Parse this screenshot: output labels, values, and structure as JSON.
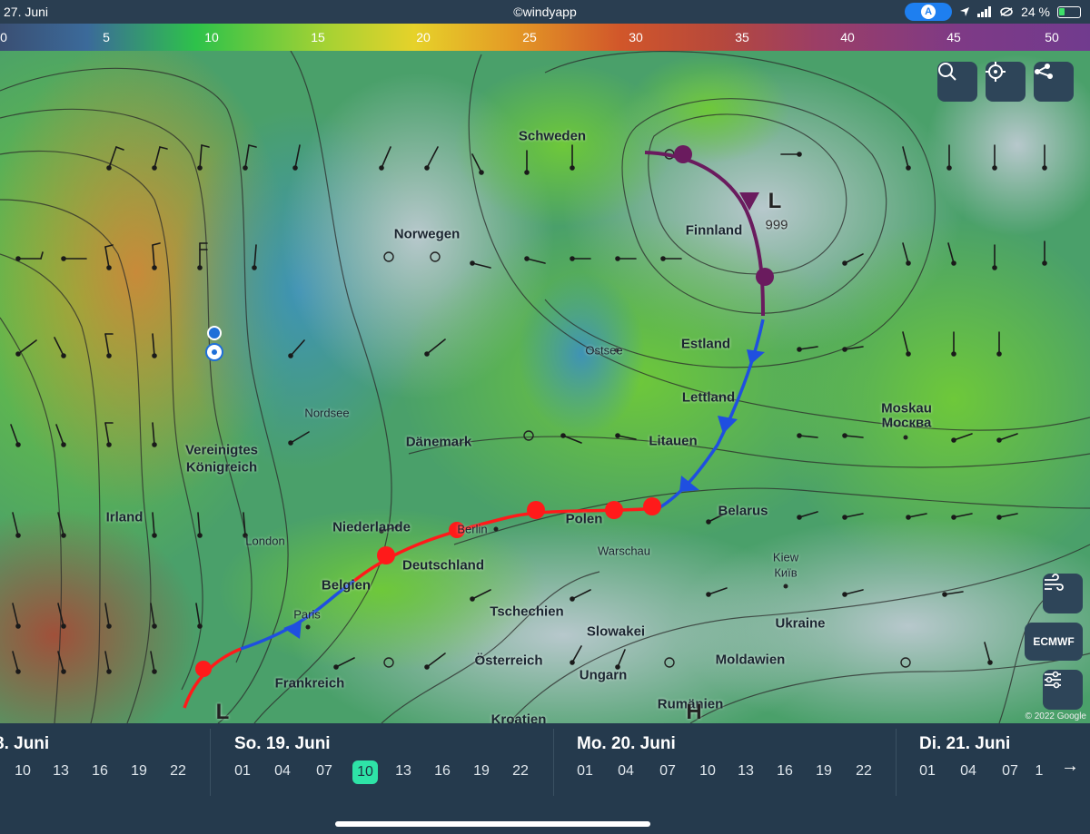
{
  "status": {
    "date": "27. Juni",
    "watermark": "©windyapp",
    "nav_letter": "A",
    "battery": "24 %"
  },
  "scale": {
    "ticks": [
      "0",
      "5",
      "10",
      "15",
      "20",
      "25",
      "30",
      "35",
      "40",
      "45",
      "50"
    ]
  },
  "map": {
    "labels": {
      "schweden": "Schweden",
      "norwegen": "Norwegen",
      "finnland": "Finnland",
      "estland": "Estland",
      "lettland": "Lettland",
      "litauen": "Litauen",
      "moskau_de": "Moskau",
      "moskau_ru": "Москва",
      "daenemark": "Dänemark",
      "nordsee": "Nordsee",
      "ver_koenigreich_1": "Vereinigtes",
      "ver_koenigreich_2": "Königreich",
      "irland": "Irland",
      "london": "London",
      "niederlande": "Niederlande",
      "berlin": "Berlin",
      "polen": "Polen",
      "warschau": "Warschau",
      "belarus": "Belarus",
      "belgien": "Belgien",
      "deutschland": "Deutschland",
      "paris": "Paris",
      "kiew_de": "Kiew",
      "kiew_ua": "Київ",
      "tschechien": "Tschechien",
      "slowakei": "Slowakei",
      "ukraine": "Ukraine",
      "oesterreich": "Österreich",
      "moldawien": "Moldawien",
      "frankreich": "Frankreich",
      "ungarn": "Ungarn",
      "rumaenien": "Rumänien",
      "kroatien": "Kroatien",
      "ostsee": "Ostsee"
    },
    "pressure_value": "999",
    "low_symbol": "L",
    "high_symbol": "H",
    "copyright": "© 2022 Google",
    "model_button": "ECMWF"
  },
  "timeline": {
    "days": [
      {
        "name": "8. Juni",
        "hours": [
          "10",
          "13",
          "16",
          "19",
          "22"
        ]
      },
      {
        "name": "So. 19. Juni",
        "hours": [
          "01",
          "04",
          "07",
          "10",
          "13",
          "16",
          "19",
          "22"
        ],
        "selected": "10"
      },
      {
        "name": "Mo. 20. Juni",
        "hours": [
          "01",
          "04",
          "07",
          "10",
          "13",
          "16",
          "19",
          "22"
        ]
      },
      {
        "name": "Di. 21. Juni",
        "hours": [
          "01",
          "04",
          "07",
          "1"
        ]
      }
    ]
  },
  "colors": {
    "cold_front": "#1f4fe0",
    "warm_front": "#ff1a1a",
    "occluded_front": "#6a1b5e",
    "selected_hour": "#2ee3a7"
  }
}
